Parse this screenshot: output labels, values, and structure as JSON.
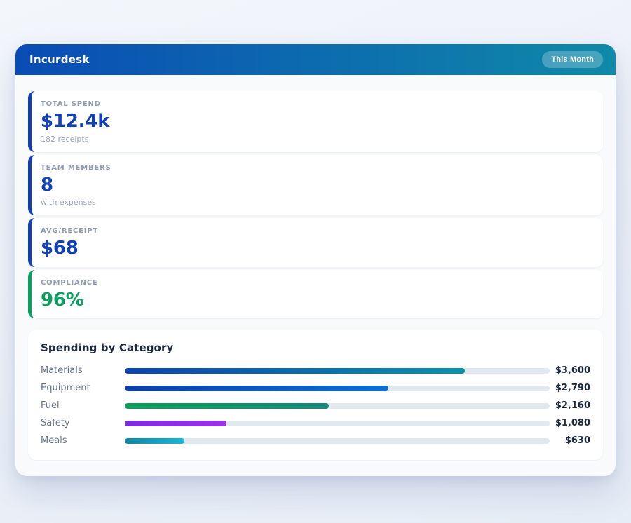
{
  "header": {
    "title": "Incurdesk",
    "badge": "This Month",
    "gradient_from": "#0a4cb5",
    "gradient_to": "#0f8aa8"
  },
  "stats": [
    {
      "label": "TOTAL SPEND",
      "value": "$12.4k",
      "sub": "182 receipts",
      "accent": "#1141b5"
    },
    {
      "label": "TEAM MEMBERS",
      "value": "8",
      "sub": "with expenses",
      "accent": "#1141b5"
    },
    {
      "label": "AVG/RECEIPT",
      "value": "$68",
      "sub": "",
      "accent": "#1141b5"
    },
    {
      "label": "COMPLIANCE",
      "value": "96%",
      "sub": "",
      "accent": "#0a9e60"
    }
  ],
  "spending": {
    "title": "Spending by Category",
    "rows": [
      {
        "label": "Materials",
        "amount": "$3,600",
        "percent": 80,
        "from": "#0d43ad",
        "to": "#0a90aa"
      },
      {
        "label": "Equipment",
        "amount": "$2,790",
        "percent": 62,
        "from": "#0d3fa8",
        "to": "#0b70d4"
      },
      {
        "label": "Fuel",
        "amount": "$2,160",
        "percent": 48,
        "from": "#09a156",
        "to": "#15897c"
      },
      {
        "label": "Safety",
        "amount": "$1,080",
        "percent": 24,
        "from": "#7c2be0",
        "to": "#9d32e8"
      },
      {
        "label": "Meals",
        "amount": "$630",
        "percent": 14,
        "from": "#0d86a4",
        "to": "#16b8d8"
      }
    ]
  },
  "chart_data": {
    "type": "bar",
    "orientation": "horizontal",
    "title": "Spending by Category",
    "categories": [
      "Materials",
      "Equipment",
      "Fuel",
      "Safety",
      "Meals"
    ],
    "values": [
      3600,
      2790,
      2160,
      1080,
      630
    ],
    "value_labels": [
      "$3,600",
      "$2,790",
      "$2,160",
      "$1,080",
      "$630"
    ],
    "xlabel": "",
    "ylabel": "",
    "xlim": [
      0,
      4500
    ],
    "grid": false,
    "legend": false
  }
}
